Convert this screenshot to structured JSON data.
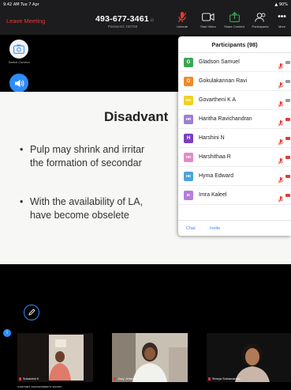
{
  "status": {
    "time": "9:42 AM  Tue 7 Apr",
    "battery": "90%"
  },
  "toolbar": {
    "leave_label": "Leave Meeting",
    "meeting_id": "493-677-3461",
    "password": "Password: 230766",
    "tools": [
      {
        "name": "unmute",
        "label": "Unmute",
        "icon": "mic-muted-icon"
      },
      {
        "name": "start-video",
        "label": "Start Video",
        "icon": "video-camera-icon"
      },
      {
        "name": "share-content",
        "label": "Share Content",
        "icon": "share-arrow-icon"
      },
      {
        "name": "participants",
        "label": "Participants",
        "icon": "participants-icon"
      },
      {
        "name": "more",
        "label": "More",
        "icon": "more-dots-icon"
      }
    ]
  },
  "side": {
    "switch_camera_label": "Switch Camera",
    "audio_label": "Disconnect"
  },
  "slide": {
    "title": "Disadvant",
    "bullets": [
      {
        "line1": "Pulp may shrink and irritar",
        "line2": "the formation of secondar"
      },
      {
        "line1": "With the availability of LA,",
        "line2": "have become obselete"
      }
    ]
  },
  "participants": {
    "title": "Participants (98)",
    "list": [
      {
        "name": "Gladson Samuel",
        "initial": "G",
        "color": "#3aa655",
        "cam_red": false
      },
      {
        "name": "Gokulakannan Ravi",
        "initial": "G",
        "color": "#f08a24",
        "cam_red": false
      },
      {
        "name": "Govartheni K A",
        "initial": "GK",
        "color": "#f2d024",
        "cam_red": false
      },
      {
        "name": "Haritha Ravichandran",
        "initial": "HR",
        "color": "#9d7fd6",
        "cam_red": true
      },
      {
        "name": "Harshini N",
        "initial": "H",
        "color": "#7b3fbf",
        "cam_red": true
      },
      {
        "name": "Harshithaa R",
        "initial": "HR",
        "color": "#e58ac6",
        "cam_red": true
      },
      {
        "name": "Hyma Edward",
        "initial": "HE",
        "color": "#4aa3df",
        "cam_red": true
      },
      {
        "name": "Imra Kaleel",
        "initial": "IK",
        "color": "#b57edc",
        "cam_red": true
      }
    ],
    "chat_label": "Chat",
    "invite_label": "Invite"
  },
  "gallery": {
    "thumbs": [
      {
        "label": "Subashini K"
      },
      {
        "label": "Jincy Jenisha"
      },
      {
        "label": "Shreya Subramanian"
      }
    ],
    "owner_label": "ruckmani arunachalam's screen"
  },
  "colors": {
    "accent": "#2d8cff",
    "danger": "#e53935",
    "toolbar_bg": "#1c1c1e"
  }
}
